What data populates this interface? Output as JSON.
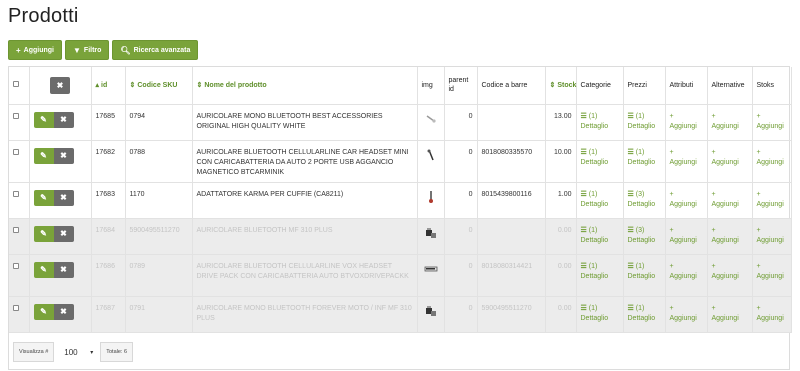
{
  "page": {
    "title": "Prodotti"
  },
  "toolbar": {
    "add_label": "Aggiungi",
    "filter_label": "Filtro",
    "search_label": "Ricerca avanzata"
  },
  "colors": {
    "accent": "#7aa33a",
    "delete": "#6b6b6b",
    "link": "#6e9c31",
    "ghost_row": "#ececec"
  },
  "columns": {
    "id": "id",
    "sku": "Codice SKU",
    "name": "Nome del prodotto",
    "img": "img",
    "parent": "parent id",
    "barcode": "Codice a barre",
    "stock": "Stock",
    "categories": "Categorie",
    "prices": "Prezzi",
    "attributes": "Attributi",
    "alternatives": "Alternative",
    "stoks": "Stoks"
  },
  "rows": [
    {
      "id": "17685",
      "sku": "0794",
      "name": "AURICOLARE MONO BLUETOOTH BEST ACCESSORIES ORIGINAL HIGH QUALITY WHITE",
      "img": "earpiece-icon",
      "parent": "0",
      "barcode": "",
      "stock": "13.00",
      "cat_count": "(1)",
      "cat_link": "Dettaglio",
      "price_count": "(1)",
      "price_link": "Dettaglio",
      "attr_link": "Aggiungi",
      "alt_link": "Aggiungi",
      "stoks_link": "Aggiungi"
    },
    {
      "id": "17682",
      "sku": "0788",
      "name": "AURICOLARE BLUETOOTH CELLULARLINE CAR HEADSET MINI CON CARICABATTERIA DA AUTO 2 PORTE USB AGGANCIO MAGNETICO BTCARMINIK",
      "img": "headset-icon",
      "parent": "0",
      "barcode": "8018080335570",
      "stock": "10.00",
      "cat_count": "(1)",
      "cat_link": "Dettaglio",
      "price_count": "(1)",
      "price_link": "Dettaglio",
      "attr_link": "Aggiungi",
      "alt_link": "Aggiungi",
      "stoks_link": "Aggiungi"
    },
    {
      "id": "17683",
      "sku": "1170",
      "name": "ADATTATORE KARMA PER CUFFIE (CA8211)",
      "img": "adapter-icon",
      "parent": "0",
      "barcode": "8015439800116",
      "stock": "1.00",
      "cat_count": "(1)",
      "cat_link": "Dettaglio",
      "price_count": "(3)",
      "price_link": "Dettaglio",
      "attr_link": "Aggiungi",
      "alt_link": "Aggiungi",
      "stoks_link": "Aggiungi"
    },
    {
      "id": "17684",
      "sku": "5900495511270",
      "name": "AURICOLARE BLUETOOTH MF 310 PLUS",
      "img": "product-box-icon",
      "parent": "0",
      "barcode": "",
      "stock": "0.00",
      "cat_count": "(1)",
      "cat_link": "Dettaglio",
      "price_count": "(3)",
      "price_link": "Dettaglio",
      "attr_link": "Aggiungi",
      "alt_link": "Aggiungi",
      "stoks_link": "Aggiungi"
    },
    {
      "id": "17686",
      "sku": "0789",
      "name": "AURICOLARE BLUETOOTH CELLULARLINE VOX HEADSET DRIVE PACK CON CARICABATTERIA AUTO BTVOXDRIVEPACKK",
      "img": "product-card-icon",
      "parent": "0",
      "barcode": "8018080314421",
      "stock": "0.00",
      "cat_count": "(1)",
      "cat_link": "Dettaglio",
      "price_count": "(1)",
      "price_link": "Dettaglio",
      "attr_link": "Aggiungi",
      "alt_link": "Aggiungi",
      "stoks_link": "Aggiungi"
    },
    {
      "id": "17687",
      "sku": "0791",
      "name": "AURICOLARE MONO BLUETOOTH FOREVER MOTO / INF MF 310 PLUS",
      "img": "product-box-icon",
      "parent": "0",
      "barcode": "5900495511270",
      "stock": "0.00",
      "cat_count": "(1)",
      "cat_link": "Dettaglio",
      "price_count": "(1)",
      "price_link": "Dettaglio",
      "attr_link": "Aggiungi",
      "alt_link": "Aggiungi",
      "stoks_link": "Aggiungi"
    }
  ],
  "footer": {
    "show_label": "Visualizza #",
    "page_size": "100",
    "total_label": "Totale: 6"
  }
}
